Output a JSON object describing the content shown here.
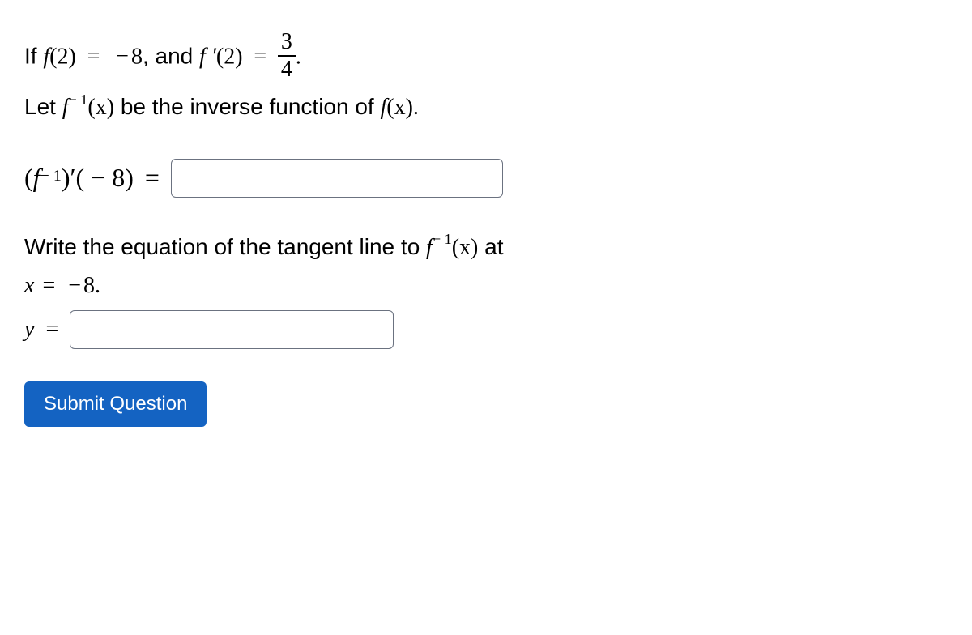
{
  "problem": {
    "line1_prefix": "If ",
    "f": "f",
    "l1_arg1": "(2)",
    "eq": "=",
    "neg": "−",
    "l1_val1": "8",
    "l1_sep": ", and ",
    "fprime": "f ′",
    "l1_arg2": "(2)",
    "frac_num": "3",
    "frac_den": "4",
    "period": ".",
    "line2_prefix": "Let ",
    "finv_sup": "− 1",
    "l2_arg": "(x)",
    "line2_mid": " be the inverse function of ",
    "l2_arg2": "(x)",
    "q1_expr_open": "(",
    "q1_expr_close": ")",
    "q1_prime": "′",
    "q1_arg": "( − 8)",
    "q2_text_a": "Write the equation of the tangent line to ",
    "q2_text_b": " at",
    "q2_x": "x",
    "q2_xval": "8",
    "q2_period": ".",
    "q2_y": "y"
  },
  "button": {
    "submit": "Submit Question"
  }
}
